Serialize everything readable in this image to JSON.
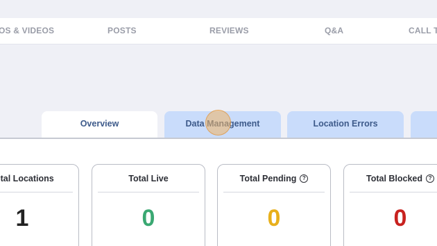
{
  "top_nav": {
    "items": [
      "OS & VIDEOS",
      "POSTS",
      "REVIEWS",
      "Q&A",
      "CALL TR"
    ]
  },
  "tabs": [
    {
      "label": "Overview",
      "active": true
    },
    {
      "label": "Data Management",
      "active": false
    },
    {
      "label": "Location Errors",
      "active": false
    },
    {
      "label": "",
      "active": false
    }
  ],
  "cards": [
    {
      "title": "Total Locations",
      "value": "1",
      "has_help": false,
      "color": "#222222"
    },
    {
      "title": "Total Live",
      "value": "0",
      "has_help": false,
      "color": "#3aa872"
    },
    {
      "title": "Total Pending",
      "value": "0",
      "has_help": true,
      "color": "#e8b01c"
    },
    {
      "title": "Total Blocked",
      "value": "0",
      "has_help": true,
      "color": "#c8221f"
    }
  ],
  "icons": {
    "help": "?"
  }
}
